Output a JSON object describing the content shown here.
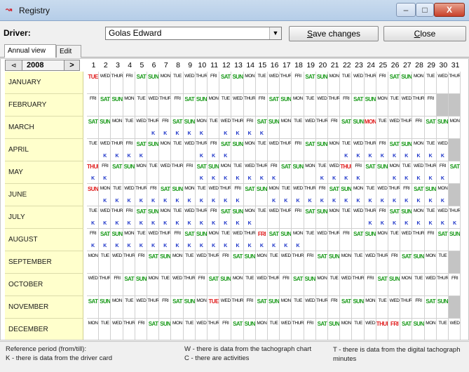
{
  "window": {
    "title": "Registry",
    "min_label": "–",
    "max_label": "□",
    "close_label": "X"
  },
  "toolbar": {
    "driver_label": "Driver:",
    "driver_value": "Golas Edward",
    "save_label": "Save changes",
    "save_mnemonic": "S",
    "close_label": "Close",
    "close_mnemonic": "C"
  },
  "tabs": [
    {
      "label": "Annual view",
      "active": true
    },
    {
      "label": "Edit",
      "active": false
    }
  ],
  "year_nav": {
    "prev_label": "⊲",
    "year": "2008",
    "next_label": ">"
  },
  "days_header": [
    "1",
    "2",
    "3",
    "4",
    "5",
    "6",
    "7",
    "8",
    "9",
    "10",
    "11",
    "12",
    "13",
    "14",
    "15",
    "16",
    "17",
    "18",
    "19",
    "20",
    "21",
    "22",
    "23",
    "24",
    "25",
    "26",
    "27",
    "28",
    "29",
    "30",
    "31"
  ],
  "colors": {
    "weekend": "#1a9a1a",
    "holiday": "#e01e1e",
    "card_mark": "#1a32c8",
    "month_bg": "#ffffcc"
  },
  "calendar": [
    {
      "month": "JANUARY",
      "first_weekday": 1,
      "days_in_month": 31,
      "holidays": [
        1
      ],
      "k_days": []
    },
    {
      "month": "FEBRUARY",
      "first_weekday": 4,
      "days_in_month": 29,
      "holidays": [],
      "k_days": []
    },
    {
      "month": "MARCH",
      "first_weekday": 5,
      "days_in_month": 31,
      "holidays": [
        24
      ],
      "k_days": [
        6,
        7,
        8,
        9,
        10,
        12,
        13,
        14,
        15
      ]
    },
    {
      "month": "APRIL",
      "first_weekday": 1,
      "days_in_month": 30,
      "holidays": [],
      "k_days": [
        2,
        3,
        4,
        5,
        10,
        11,
        12,
        22,
        23,
        24,
        25,
        26,
        27,
        28,
        29,
        30
      ]
    },
    {
      "month": "MAY",
      "first_weekday": 3,
      "days_in_month": 31,
      "holidays": [
        1,
        22
      ],
      "k_days": [
        1,
        2,
        10,
        11,
        12,
        13,
        14,
        15,
        16,
        20,
        21,
        22,
        23,
        26,
        27,
        28,
        29,
        30
      ]
    },
    {
      "month": "JUNE",
      "first_weekday": 6,
      "days_in_month": 30,
      "holidays": [
        1
      ],
      "k_days": [
        2,
        3,
        4,
        5,
        6,
        7,
        8,
        9,
        10,
        11,
        12,
        13,
        16,
        17,
        18,
        19,
        20,
        21,
        22,
        23,
        24,
        25,
        26,
        27,
        28,
        29,
        30
      ]
    },
    {
      "month": "JULY",
      "first_weekday": 1,
      "days_in_month": 31,
      "holidays": [],
      "k_days": [
        1,
        2,
        3,
        4,
        5,
        6,
        7,
        8,
        9,
        10,
        11,
        12,
        13,
        14,
        24,
        25,
        26,
        27,
        28,
        29,
        30,
        31
      ]
    },
    {
      "month": "AUGUST",
      "first_weekday": 4,
      "days_in_month": 31,
      "holidays": [
        15
      ],
      "k_days": [
        1,
        2,
        3,
        4,
        5,
        6,
        7,
        8,
        9,
        10,
        11,
        12,
        13,
        14,
        15,
        16,
        17,
        18
      ]
    },
    {
      "month": "SEPTEMBER",
      "first_weekday": 0,
      "days_in_month": 30,
      "holidays": [],
      "k_days": []
    },
    {
      "month": "OCTOBER",
      "first_weekday": 2,
      "days_in_month": 31,
      "holidays": [],
      "k_days": []
    },
    {
      "month": "NOVEMBER",
      "first_weekday": 5,
      "days_in_month": 30,
      "holidays": [
        11
      ],
      "k_days": []
    },
    {
      "month": "DECEMBER",
      "first_weekday": 0,
      "days_in_month": 31,
      "holidays": [
        25,
        26
      ],
      "k_days": []
    }
  ],
  "weekday_abbr": [
    "MON",
    "TUE",
    "WED",
    "THUR",
    "FRI",
    "SAT",
    "SUN"
  ],
  "legend": {
    "reference": "Reference period (from/till):",
    "k_card": "K - there is data from the driver card",
    "w_chart": "W - there is data from the tachograph chart",
    "c_activities": "C - there are activities",
    "t_digital": "T - there is data from the digital tachograph minutes"
  }
}
